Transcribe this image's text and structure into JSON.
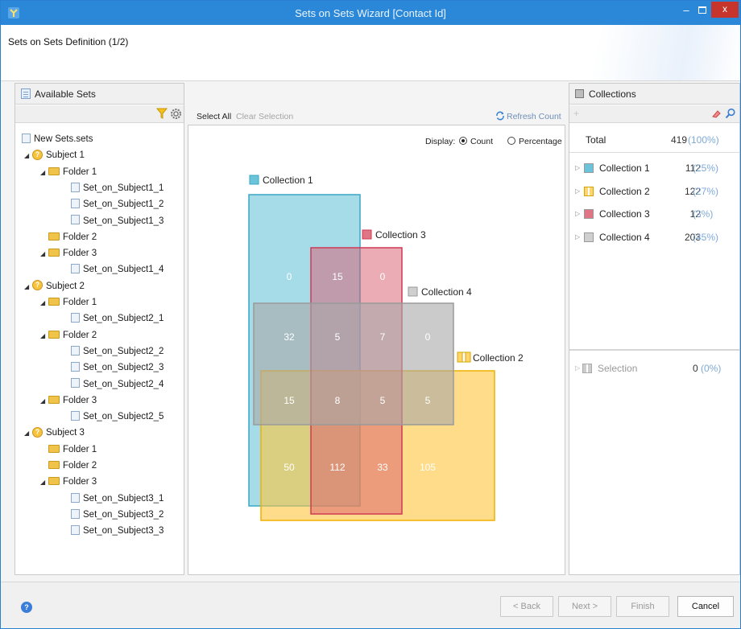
{
  "window": {
    "title": "Sets on Sets Wizard [Contact Id]",
    "minimize_label": "–",
    "close_label": "x"
  },
  "header": {
    "title": "Sets on Sets Definition (1/2)"
  },
  "available_sets": {
    "title": "Available Sets",
    "tree": [
      {
        "label": "New Sets.sets",
        "type": "file",
        "depth": 0,
        "expanded": null
      },
      {
        "label": "Subject 1",
        "type": "subject",
        "depth": 1,
        "expanded": true
      },
      {
        "label": "Folder 1",
        "type": "folder",
        "depth": 2,
        "expanded": true
      },
      {
        "label": "Set_on_Subject1_1",
        "type": "file",
        "depth": 3,
        "expanded": null
      },
      {
        "label": "Set_on_Subject1_2",
        "type": "file",
        "depth": 3,
        "expanded": null
      },
      {
        "label": "Set_on_Subject1_3",
        "type": "file",
        "depth": 3,
        "expanded": null
      },
      {
        "label": "Folder 2",
        "type": "folder",
        "depth": 2,
        "expanded": null
      },
      {
        "label": "Folder 3",
        "type": "folder",
        "depth": 2,
        "expanded": true
      },
      {
        "label": "Set_on_Subject1_4",
        "type": "file",
        "depth": 3,
        "expanded": null
      },
      {
        "label": "Subject 2",
        "type": "subject",
        "depth": 1,
        "expanded": true
      },
      {
        "label": "Folder 1",
        "type": "folder",
        "depth": 2,
        "expanded": true
      },
      {
        "label": "Set_on_Subject2_1",
        "type": "file",
        "depth": 3,
        "expanded": null
      },
      {
        "label": "Folder 2",
        "type": "folder",
        "depth": 2,
        "expanded": true
      },
      {
        "label": "Set_on_Subject2_2",
        "type": "file",
        "depth": 3,
        "expanded": null
      },
      {
        "label": "Set_on_Subject2_3",
        "type": "file",
        "depth": 3,
        "expanded": null
      },
      {
        "label": "Set_on_Subject2_4",
        "type": "file",
        "depth": 3,
        "expanded": null
      },
      {
        "label": "Folder 3",
        "type": "folder",
        "depth": 2,
        "expanded": true
      },
      {
        "label": "Set_on_Subject2_5",
        "type": "file",
        "depth": 3,
        "expanded": null
      },
      {
        "label": "Subject 3",
        "type": "subject",
        "depth": 1,
        "expanded": true
      },
      {
        "label": "Folder 1",
        "type": "folder",
        "depth": 2,
        "expanded": null
      },
      {
        "label": "Folder 2",
        "type": "folder",
        "depth": 2,
        "expanded": null
      },
      {
        "label": "Folder 3",
        "type": "folder",
        "depth": 2,
        "expanded": true
      },
      {
        "label": "Set_on_Subject3_1",
        "type": "file",
        "depth": 3,
        "expanded": null
      },
      {
        "label": "Set_on_Subject3_2",
        "type": "file",
        "depth": 3,
        "expanded": null
      },
      {
        "label": "Set_on_Subject3_3",
        "type": "file",
        "depth": 3,
        "expanded": null
      }
    ]
  },
  "center": {
    "select_all": "Select All",
    "clear_selection": "Clear Selection",
    "refresh_count": "Refresh Count",
    "display_label": "Display:",
    "display_options": [
      "Count",
      "Percentage"
    ],
    "display_selected": "Count"
  },
  "venn": {
    "collections": [
      {
        "name": "Collection 1",
        "color": "#5bbfd6"
      },
      {
        "name": "Collection 2",
        "color": "#fdc43a"
      },
      {
        "name": "Collection 3",
        "color": "#d95a6e"
      },
      {
        "name": "Collection 4",
        "color": "#a8a8a8"
      }
    ],
    "cells": [
      [
        "0",
        "15",
        "0",
        ""
      ],
      [
        "32",
        "5",
        "7",
        "0"
      ],
      [
        "15",
        "8",
        "5",
        "5"
      ],
      [
        "50",
        "112",
        "33",
        "105"
      ]
    ]
  },
  "collections_panel": {
    "title": "Collections",
    "total_label": "Total",
    "total_count": "419",
    "total_percent": "(100%)",
    "items": [
      {
        "name": "Collection 1",
        "count": "112",
        "percent": "(25%)",
        "color": "#6cc4da"
      },
      {
        "name": "Collection 2",
        "count": "122",
        "percent": "(27%)",
        "color": "#ffd66b"
      },
      {
        "name": "Collection 3",
        "count": "12",
        "percent": "(3%)",
        "color": "#e07585"
      },
      {
        "name": "Collection 4",
        "count": "203",
        "percent": "(45%)",
        "color": "#cfcfcf"
      }
    ],
    "selection_label": "Selection",
    "selection_count": "0",
    "selection_percent": "(0%)"
  },
  "footer": {
    "back": "< Back",
    "next": "Next >",
    "finish": "Finish",
    "cancel": "Cancel"
  },
  "colors": {
    "titlebar": "#2b88d8",
    "accent_text": "#7fa9d8"
  }
}
